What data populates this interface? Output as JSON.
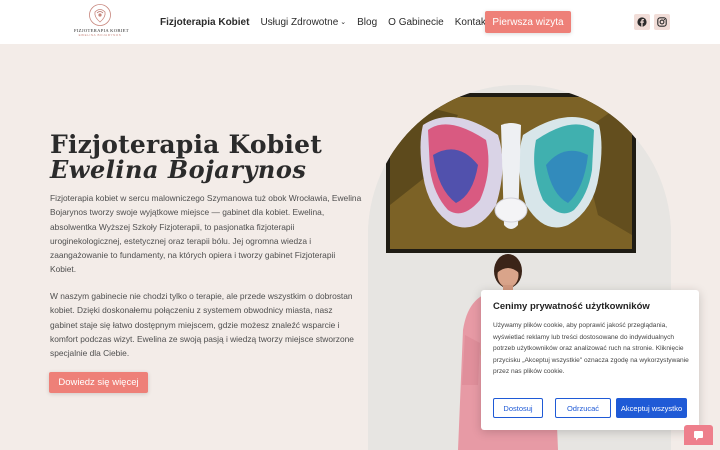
{
  "logo": {
    "name": "FIZJOTERAPIA KOBIET",
    "subtitle": "EWELINA BOJARYNOS"
  },
  "nav": {
    "items": [
      {
        "label": "Fizjoterapia Kobiet",
        "active": true
      },
      {
        "label": "Usługi Zdrowotne",
        "dropdown": true
      },
      {
        "label": "Blog"
      },
      {
        "label": "O Gabinecie"
      },
      {
        "label": "Kontakt"
      }
    ],
    "cta": "Pierwsza wizyta",
    "social": [
      "facebook-icon",
      "instagram-icon"
    ]
  },
  "hero": {
    "title": "Fizjoterapia Kobiet",
    "subtitle": "Ewelina Bojarynos",
    "paragraph1": "Fizjoterapia kobiet w sercu malowniczego Szymanowa tuż obok Wrocławia, Ewelina Bojarynos tworzy swoje wyjątkowe miejsce — gabinet dla kobiet. Ewelina, absolwentka Wyższej Szkoły Fizjoterapii, to pasjonatka fizjoterapii uroginekologicznej, estetycznej oraz terapii bólu. Jej ogromna wiedza i zaangażowanie to fundamenty, na których opiera i tworzy gabinet Fizjoterapii Kobiet.",
    "paragraph2": "W naszym gabinecie nie chodzi tylko o terapie, ale przede wszystkim o dobrostan kobiet. Dzięki doskonałemu połączeniu z systemem obwodnicy miasta, nasz gabinet staje się łatwo dostępnym miejscem, gdzie możesz znaleźć wsparcie i komfort podczas wizyt. Ewelina ze swoją pasją i wiedzą tworzy miejsce stworzone specjalnie dla Ciebie.",
    "cta": "Dowiedz się więcej"
  },
  "cookie": {
    "title": "Cenimy prywatność użytkowników",
    "text": "Używamy plików cookie, aby poprawić jakość przeglądania, wyświetlać reklamy lub treści dostosowane do indywidualnych potrzeb użytkowników oraz analizować ruch na stronie. Kliknięcie przycisku „Akceptuj wszystkie\" oznacza zgodę na wykorzystywanie przez nas plików cookie.",
    "buttons": {
      "customize": "Dostosuj",
      "reject": "Odrzucać",
      "accept": "Akceptuj wszystko"
    }
  },
  "colors": {
    "accent": "#ee8078",
    "background": "#f3ece8",
    "cookie_button": "#1f5ad6"
  }
}
